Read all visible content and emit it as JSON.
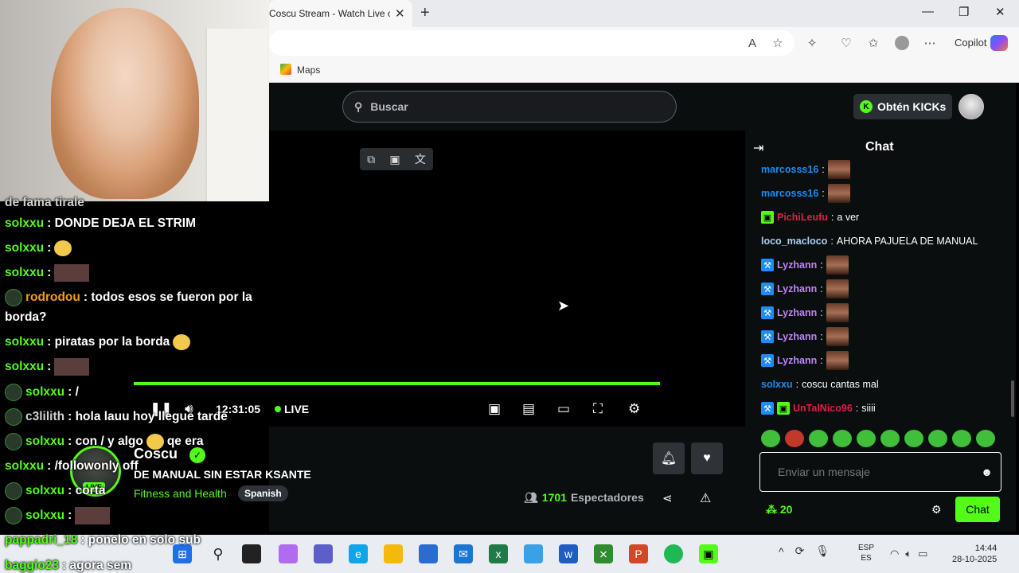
{
  "browser": {
    "tab_title": "Coscu Stream - Watch Live o",
    "tab_close": "✕",
    "new_tab": "+",
    "bookmark_maps": "Maps",
    "copilot_label": "Copilot",
    "win_min": "—",
    "win_restore": "❐",
    "win_close": "✕"
  },
  "kick": {
    "search_placeholder": "Buscar",
    "kicks_button": "Obtén KICKs",
    "player": {
      "time": "12:31:05",
      "live_label": "LIVE"
    },
    "streamer": {
      "name": "Coscu",
      "live_badge": "LIVE",
      "title": "DE MANUAL SIN ESTAR KSANTE",
      "category": "Fitness and Health",
      "language": "Spanish",
      "viewers_count": "1701",
      "viewers_label": "Espectadores"
    },
    "chat": {
      "title": "Chat",
      "messages": [
        {
          "user": "marcosss16",
          "color": "#1e8cf0",
          "text": "",
          "emote": true,
          "badges": []
        },
        {
          "user": "marcosss16",
          "color": "#1e8cf0",
          "text": "",
          "emote": true,
          "badges": []
        },
        {
          "user": "PichiLeufu",
          "color": "#e11d48",
          "text": "a ver",
          "emote": false,
          "badges": [
            "gift"
          ]
        },
        {
          "user": "loco_macloco",
          "color": "#a9d0f5",
          "text": "AHORA PAJUELA DE MANUAL",
          "emote": false,
          "badges": []
        },
        {
          "user": "Lyzhann",
          "color": "#c084fc",
          "text": "",
          "emote": true,
          "badges": [
            "pick"
          ]
        },
        {
          "user": "Lyzhann",
          "color": "#c084fc",
          "text": "",
          "emote": true,
          "badges": [
            "pick"
          ]
        },
        {
          "user": "Lyzhann",
          "color": "#c084fc",
          "text": "",
          "emote": true,
          "badges": [
            "pick"
          ]
        },
        {
          "user": "Lyzhann",
          "color": "#c084fc",
          "text": "",
          "emote": true,
          "badges": [
            "pick"
          ]
        },
        {
          "user": "Lyzhann",
          "color": "#c084fc",
          "text": "",
          "emote": true,
          "badges": [
            "pick"
          ]
        },
        {
          "user": "solxxu",
          "color": "#1e8cf0",
          "text": "coscu cantas mal",
          "emote": false,
          "badges": []
        },
        {
          "user": "UnTalNico96",
          "color": "#e11d48",
          "text": "siiii",
          "emote": false,
          "badges": [
            "pick",
            "gift"
          ]
        }
      ],
      "input_placeholder": "Enviar un mensaje",
      "kicks_count": "20",
      "send_label": "Chat"
    }
  },
  "overlay_chat": [
    {
      "user": "",
      "text": "de fama tirale",
      "cls": "gr"
    },
    {
      "user": "solxxu",
      "text": ": DONDE DEJA EL STRIM",
      "cls": ""
    },
    {
      "user": "solxxu",
      "text": ": ",
      "cls": "",
      "extra": "smiley"
    },
    {
      "user": "solxxu",
      "text": ": ",
      "cls": "",
      "extra": "img"
    },
    {
      "user": "rodrodou",
      "text": ": todos esos se fueron por la",
      "cls": "or"
    },
    {
      "user": "",
      "text": "borda?",
      "cls": ""
    },
    {
      "user": "solxxu",
      "text": ": piratas por la borda",
      "cls": "",
      "extra": "smiley"
    },
    {
      "user": "solxxu",
      "text": ": ",
      "cls": "",
      "extra": "img"
    },
    {
      "user": "solxxu",
      "text": ": /",
      "cls": ""
    },
    {
      "user": "c3lilith",
      "text": ": hola lauu hoy llegue tarde",
      "cls": "gr"
    },
    {
      "user": "solxxu",
      "text": ": con / y algo",
      "cls": "",
      "extra2": "qe era"
    },
    {
      "user": "solxxu",
      "text": ": /followonly off",
      "cls": ""
    },
    {
      "user": "solxxu",
      "text": ": corta",
      "cls": ""
    },
    {
      "user": "solxxu",
      "text": ": ",
      "cls": "",
      "extra": "img"
    },
    {
      "user": "pappadri_18",
      "text": ": ponelo en solo sub",
      "cls": ""
    },
    {
      "user": "baggio23",
      "text": ": agora sem",
      "cls": ""
    }
  ],
  "taskbar": {
    "lang_top": "ESP",
    "lang_bottom": "ES",
    "time": "14:44",
    "date": "28-10-2025"
  },
  "colors": {
    "kick_green": "#53fc18",
    "bg_dark": "#0b0e0f"
  }
}
